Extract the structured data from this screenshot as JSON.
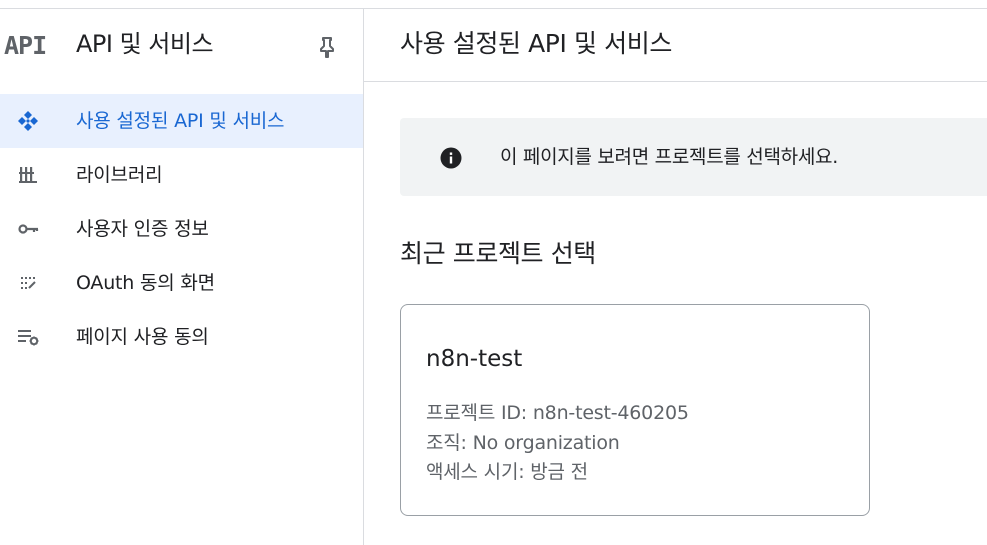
{
  "sidebar": {
    "logo_text": "API",
    "title": "API 및 서비스",
    "pin_icon": "pin-icon",
    "items": [
      {
        "label": "사용 설정된 API 및 서비스",
        "icon": "api-diamond-icon",
        "active": true
      },
      {
        "label": "라이브러리",
        "icon": "library-icon",
        "active": false
      },
      {
        "label": "사용자 인증 정보",
        "icon": "key-icon",
        "active": false
      },
      {
        "label": "OAuth 동의 화면",
        "icon": "oauth-consent-icon",
        "active": false
      },
      {
        "label": "페이지 사용 동의",
        "icon": "page-usage-agreement-icon",
        "active": false
      }
    ]
  },
  "main": {
    "title": "사용 설정된 API 및 서비스",
    "banner": {
      "icon": "info-icon",
      "text": "이 페이지를 보려면 프로젝트를 선택하세요."
    },
    "recent_title": "최근 프로젝트 선택",
    "project": {
      "name": "n8n-test",
      "id_line": "프로젝트 ID: n8n-test-460205",
      "org_line": "조직: No organization",
      "access_line": "액세스 시기: 방금 전"
    }
  },
  "colors": {
    "accent": "#1967d2",
    "active_bg": "#e8f0fe",
    "banner_bg": "#f1f3f4",
    "icon": "#5f6368"
  }
}
